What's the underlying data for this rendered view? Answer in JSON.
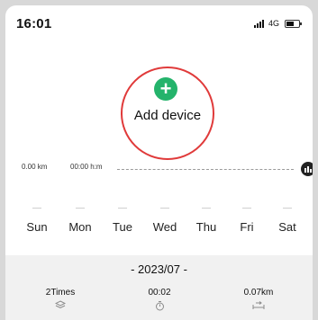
{
  "status_bar": {
    "time": "16:01",
    "network": "4G",
    "signal_icon": "signal-bars-icon",
    "battery_icon": "battery-icon"
  },
  "add_device": {
    "label": "Add device",
    "icon": "plus-circle-icon",
    "accent_color": "#24b36b",
    "highlight_color": "#e03a3a"
  },
  "summary": {
    "distance": "0.00 km",
    "duration": "00:00 h:m",
    "chart_icon": "bar-chart-icon"
  },
  "week": {
    "days": [
      "Sun",
      "Mon",
      "Tue",
      "Wed",
      "Thu",
      "Fri",
      "Sat"
    ]
  },
  "monthly": {
    "month": "- 2023/07 -",
    "times": "2Times",
    "duration": "00:02",
    "distance": "0.07km",
    "icons": [
      "layers-icon",
      "stopwatch-icon",
      "distance-icon"
    ]
  }
}
